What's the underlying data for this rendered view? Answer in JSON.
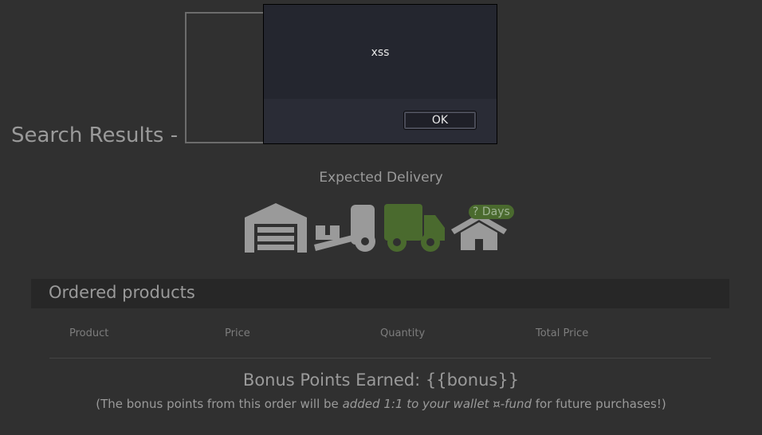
{
  "search": {
    "title": "Search Results -"
  },
  "alert": {
    "message": "xss",
    "ok_label": "OK"
  },
  "delivery": {
    "title": "Expected Delivery",
    "days_badge": "? Days",
    "stages": [
      "warehouse-icon",
      "forklift-icon",
      "truck-icon",
      "home-icon"
    ],
    "active_color": "#4a6a2e",
    "inactive_color": "#9a9a9a"
  },
  "orders": {
    "title": "Ordered products",
    "columns": [
      "Product",
      "Price",
      "Quantity",
      "Total Price"
    ]
  },
  "bonus": {
    "title": "Bonus Points Earned: {{bonus}}",
    "note_prefix": "(The bonus points from this order will be ",
    "note_emphasis": "added 1:1 to your wallet ¤-fund",
    "note_suffix": " for future purchases!)"
  }
}
